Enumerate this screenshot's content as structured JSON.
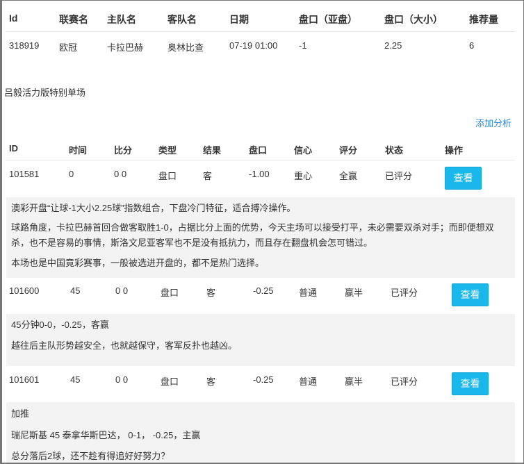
{
  "match_table": {
    "headers": [
      "Id",
      "联赛名",
      "主队名",
      "客队名",
      "日期",
      "盘口（亚盘）",
      "盘口（大小）",
      "推荐量"
    ],
    "row": [
      "318919",
      "欧冠",
      "卡拉巴赫",
      "奥林比查",
      "07-19 01:00",
      "-1",
      "2.25",
      "6"
    ]
  },
  "section_title": "吕毅活力版特别单场",
  "add_analysis_link": "添加分析",
  "analysis_table": {
    "headers": [
      "ID",
      "时间",
      "比分",
      "类型",
      "结果",
      "盘口",
      "信心",
      "评分",
      "状态",
      "操作"
    ],
    "rows": [
      {
        "cells": [
          "101581",
          "0",
          "0 0",
          "盘口",
          "客",
          "-1.00",
          "重心",
          "全赢",
          "已评分"
        ],
        "action": "查看",
        "notes": [
          "澳彩开盘“让球-1大小2.25球”指数组合，下盘冷门特征，适合搏冷操作。",
          "球路角度，卡拉巴赫首回合做客取胜1-0，占据比分上面的优势，今天主场可以接受打平，未必需要双杀对手；而即便想双杀，也不是容易的事情，斯洛文尼亚客军也不是没有抵抗力，而且存在翻盘机会怎可错过。",
          "本场也是中国竟彩赛事，一般被选进开盘的，都不是热门选择。"
        ]
      },
      {
        "cells": [
          "101600",
          "45",
          "0 0",
          "盘口",
          "客",
          "-0.25",
          "普通",
          "赢半",
          "已评分"
        ],
        "action": "查看",
        "notes": [
          "45分钟0-0，-0.25，客赢",
          "越往后主队形势越安全，也就越保守，客军反扑也越凶。"
        ]
      },
      {
        "cells": [
          "101601",
          "45",
          "0 0",
          "盘口",
          "客",
          "-0.25",
          "普通",
          "赢半",
          "已评分"
        ],
        "action": "查看",
        "notes": [
          "加推",
          "瑞尼斯基 45 泰拿华斯巴达， 0-1， -0.25，主赢",
          "总分落后2球，还不趁有得追好好努力？"
        ]
      }
    ]
  }
}
